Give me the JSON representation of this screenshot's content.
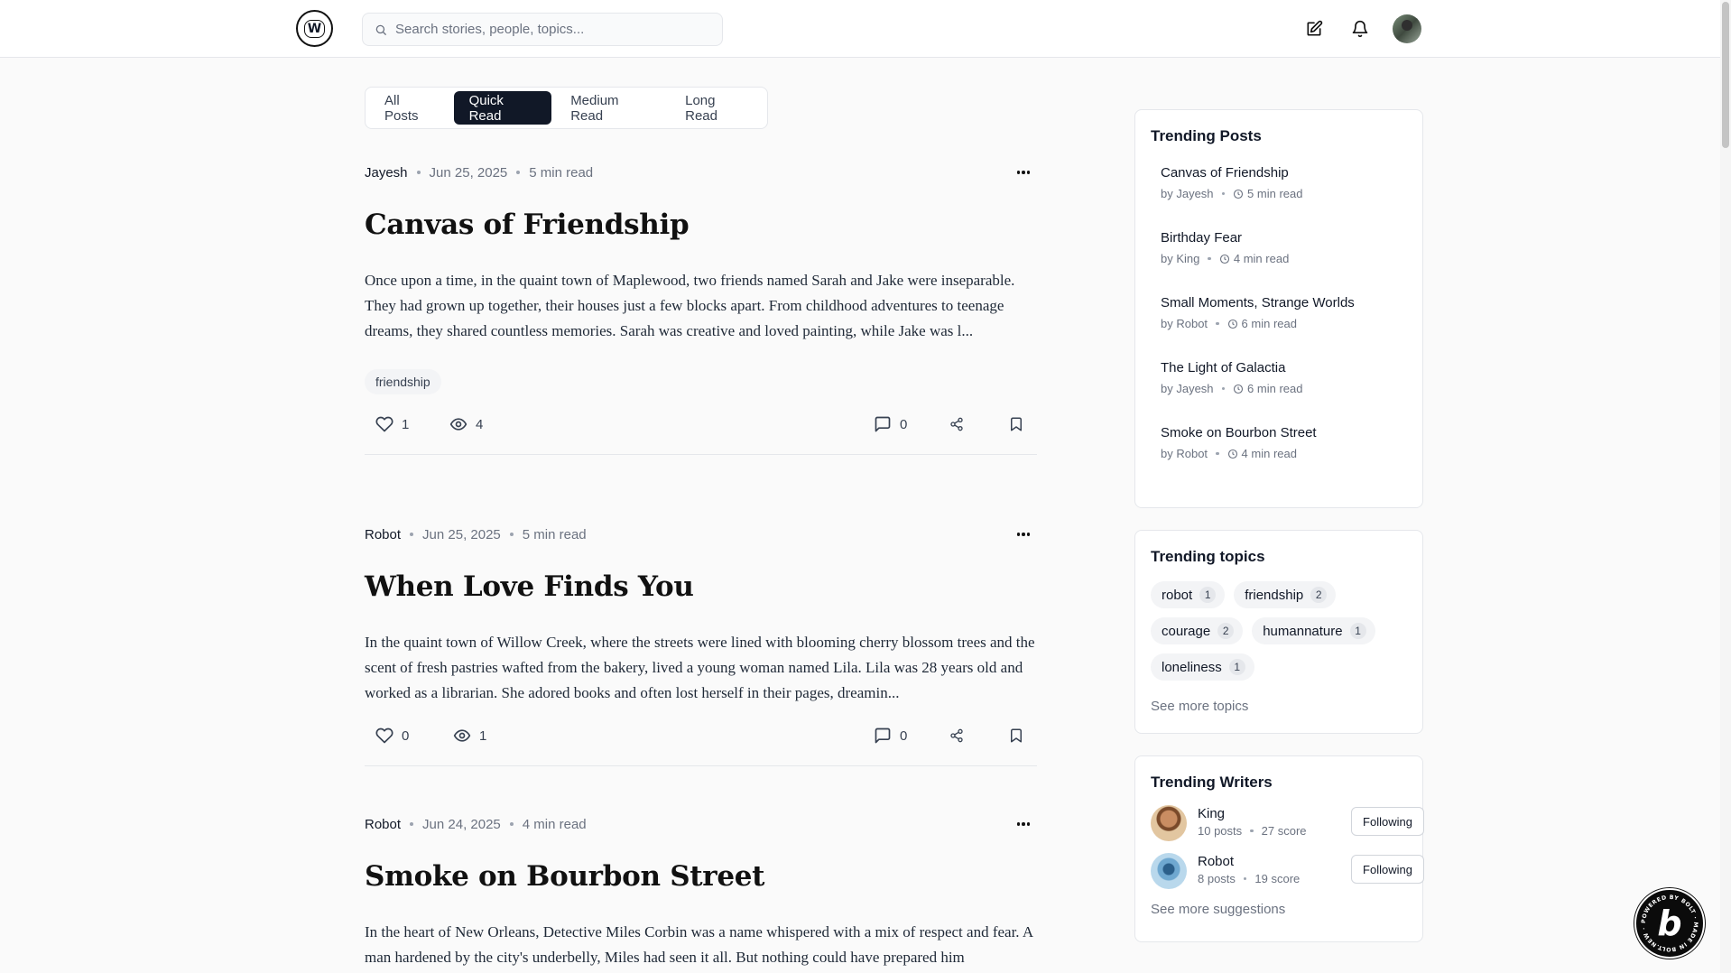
{
  "header": {
    "logo_text": "W",
    "search_placeholder": "Search stories, people, topics..."
  },
  "tabs": [
    {
      "label": "All Posts",
      "active": false
    },
    {
      "label": "Quick Read",
      "active": true
    },
    {
      "label": "Medium Read",
      "active": false
    },
    {
      "label": "Long Read",
      "active": false
    }
  ],
  "posts": [
    {
      "author": "Jayesh",
      "date": "Jun 25, 2025",
      "read_time": "5 min read",
      "title": "Canvas of Friendship",
      "excerpt": "Once upon a time, in the quaint town of Maplewood, two friends named Sarah and Jake were inseparable. They had grown up together, their houses just a few blocks apart. From childhood adventures to teenage dreams, they shared countless memories. Sarah was creative and loved painting, while Jake was l...",
      "tag": "friendship",
      "likes": "1",
      "views": "4",
      "comments": "0"
    },
    {
      "author": "Robot",
      "date": "Jun 25, 2025",
      "read_time": "5 min read",
      "title": "When Love Finds You",
      "excerpt": "In the quaint town of Willow Creek, where the streets were lined with blooming cherry blossom trees and the scent of fresh pastries wafted from the bakery, lived a young woman named Lila. Lila was 28 years old and worked as a librarian. She adored books and often lost herself in their pages, dreamin...",
      "likes": "0",
      "views": "1",
      "comments": "0"
    },
    {
      "author": "Robot",
      "date": "Jun 24, 2025",
      "read_time": "4 min read",
      "title": "Smoke on Bourbon Street",
      "excerpt": "In the heart of New Orleans, Detective Miles Corbin was a name whispered with a mix of respect and fear. A man hardened by the city's underbelly, Miles had seen it all. But nothing could have prepared him"
    }
  ],
  "trending_posts": {
    "heading": "Trending Posts",
    "items": [
      {
        "title": "Canvas of Friendship",
        "by": "by Jayesh",
        "read": "5 min read"
      },
      {
        "title": "Birthday Fear",
        "by": "by King",
        "read": "4 min read"
      },
      {
        "title": "Small Moments, Strange Worlds",
        "by": "by Robot",
        "read": "6 min read"
      },
      {
        "title": "The Light of Galactia",
        "by": "by Jayesh",
        "read": "6 min read"
      },
      {
        "title": "Smoke on Bourbon Street",
        "by": "by Robot",
        "read": "4 min read"
      }
    ]
  },
  "trending_topics": {
    "heading": "Trending topics",
    "items": [
      {
        "name": "robot",
        "count": "1"
      },
      {
        "name": "friendship",
        "count": "2"
      },
      {
        "name": "courage",
        "count": "2"
      },
      {
        "name": "humannature",
        "count": "1"
      },
      {
        "name": "loneliness",
        "count": "1"
      }
    ],
    "see_more": "See more topics"
  },
  "trending_writers": {
    "heading": "Trending Writers",
    "items": [
      {
        "name": "King",
        "posts": "10 posts",
        "score": "27 score",
        "button": "Following"
      },
      {
        "name": "Robot",
        "posts": "8 posts",
        "score": "19 score",
        "button": "Following"
      }
    ],
    "see_more": "See more suggestions"
  },
  "badge": {
    "letter": "b",
    "ring_text": "POWERED BY BOLT · MADE IN BOLT.NEW ·"
  },
  "colors": {
    "accent": "#111827",
    "muted": "#6b7280",
    "border": "#e5e7eb",
    "chip_bg": "#f3f4f6"
  }
}
